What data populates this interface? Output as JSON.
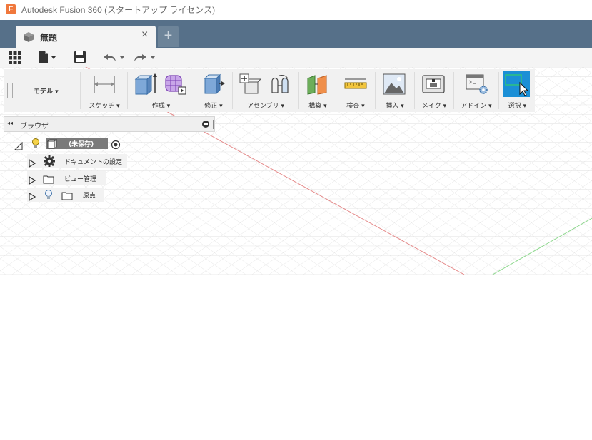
{
  "window": {
    "title": "Autodesk Fusion 360 (スタートアップ ライセンス)",
    "logo_letter": "F"
  },
  "tabs": {
    "document_tab": {
      "label": "無題",
      "icon": "cube-icon",
      "close": "×"
    },
    "new_tab": "+"
  },
  "quick_access": {
    "items": [
      "grid-menu-icon",
      "file-icon",
      "save-icon",
      "undo-icon",
      "redo-icon"
    ]
  },
  "toolbar": {
    "workspace": "モデル ▾",
    "groups": [
      {
        "label": "スケッチ ▾"
      },
      {
        "label": "作成 ▾"
      },
      {
        "label": "修正 ▾"
      },
      {
        "label": "アセンブリ ▾"
      },
      {
        "label": "構築 ▾"
      },
      {
        "label": "検査 ▾"
      },
      {
        "label": "挿入 ▾"
      },
      {
        "label": "メイク ▾"
      },
      {
        "label": "アドイン ▾"
      },
      {
        "label": "選択 ▾"
      }
    ]
  },
  "browser": {
    "title": "ブラウザ",
    "collapse": "◂◂",
    "root": {
      "label": "(未保存)"
    },
    "items": [
      {
        "label": "ドキュメントの設定",
        "icon": "gear-icon"
      },
      {
        "label": "ビュー管理",
        "icon": "folder-icon"
      },
      {
        "label": "原点",
        "icon": "folder-icon"
      }
    ]
  },
  "colors": {
    "tabbar": "#567089",
    "select_blue": "#1b8fd6",
    "axis_red": "#e06666",
    "axis_green": "#66cc66"
  }
}
